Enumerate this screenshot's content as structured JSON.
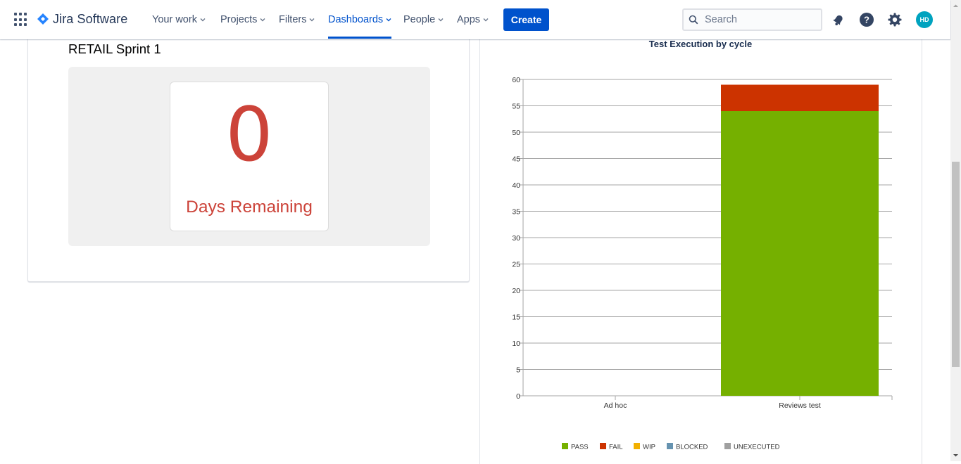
{
  "nav": {
    "logo": "Jira Software",
    "items": [
      {
        "label": "Your work"
      },
      {
        "label": "Projects"
      },
      {
        "label": "Filters"
      },
      {
        "label": "Dashboards",
        "active": true
      },
      {
        "label": "People"
      },
      {
        "label": "Apps"
      }
    ],
    "create_label": "Create",
    "search_placeholder": "Search",
    "avatar_initials": "HD",
    "accent": "#0052cc"
  },
  "sprint_gadget": {
    "title": "RETAIL Sprint 1",
    "days_value": "0",
    "days_label": "Days Remaining",
    "color": "#cc4339"
  },
  "chart_data": {
    "type": "bar",
    "stacked": true,
    "title": "Test Execution by cycle",
    "categories": [
      "Ad hoc",
      "Reviews test"
    ],
    "series": [
      {
        "name": "PASS",
        "values": [
          0,
          54
        ],
        "color": "#75b000"
      },
      {
        "name": "FAIL",
        "values": [
          0,
          5
        ],
        "color": "#cc3300"
      },
      {
        "name": "WIP",
        "values": [
          0,
          0
        ],
        "color": "#f2b000"
      },
      {
        "name": "BLOCKED",
        "values": [
          0,
          0
        ],
        "color": "#6693b0"
      },
      {
        "name": "UNEXECUTED",
        "values": [
          0,
          0
        ],
        "color": "#a0a0a0"
      }
    ],
    "ylim": [
      0,
      60
    ],
    "yticks": [
      0,
      5,
      10,
      15,
      20,
      25,
      30,
      35,
      40,
      45,
      50,
      55,
      60
    ],
    "grid": true,
    "legend_position": "bottom"
  }
}
